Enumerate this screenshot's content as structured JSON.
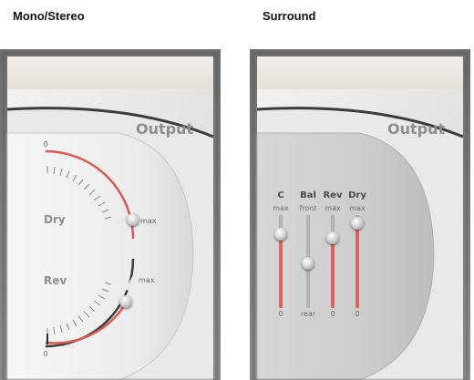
{
  "headings": {
    "left": "Mono/Stereo",
    "right": "Surround"
  },
  "mono": {
    "output_label": "Output",
    "dry": {
      "label": "Dry",
      "min_label": "0",
      "max_label": "max",
      "value": 1.0
    },
    "rev": {
      "label": "Rev",
      "min_label": "0",
      "max_label": "max",
      "value": 0.85
    }
  },
  "surround": {
    "output_label": "Output",
    "sliders": [
      {
        "label": "C",
        "top_label": "max",
        "bottom_label": "0",
        "value": 0.9
      },
      {
        "label": "Bal",
        "top_label": "front",
        "bottom_label": "rear",
        "value": 0.5
      },
      {
        "label": "Rev",
        "top_label": "max",
        "bottom_label": "0",
        "value": 0.9
      },
      {
        "label": "Dry",
        "top_label": "max",
        "bottom_label": "0",
        "value": 1.0
      }
    ]
  },
  "colors": {
    "accent": "#e0605a",
    "label_gray": "#8e8e8e"
  }
}
